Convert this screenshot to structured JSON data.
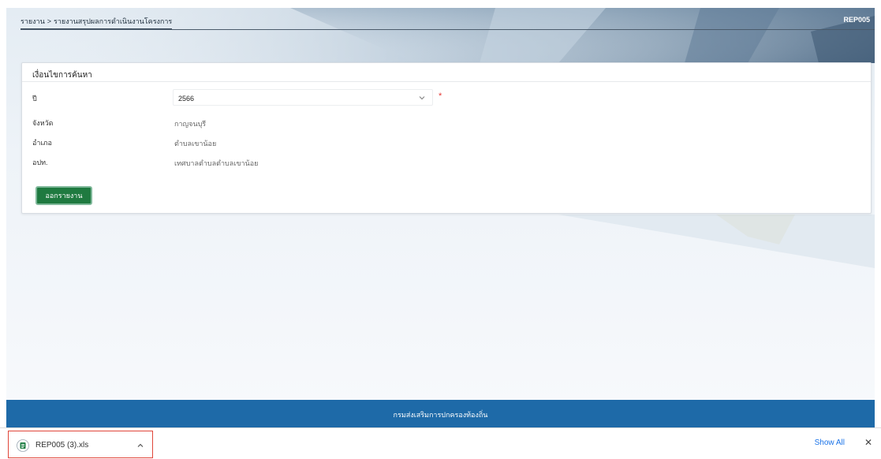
{
  "breadcrumb": {
    "parent": "รายงาน",
    "separator": ">",
    "current": "รายงานสรุปผลการดำเนินงานโครงการ"
  },
  "page_code": "REP005",
  "search": {
    "title": "เงื่อนไขการค้นหา",
    "year_label": "ปี",
    "year_value": "2566",
    "required_mark": "*",
    "province_label": "จังหวัด",
    "province_value": "กาญจนบุรี",
    "district_label": "อำเภอ",
    "district_value": "ตำบลเขาน้อย",
    "lao_label": "อปท.",
    "lao_value": "เทศบาลตำบลตำบลเขาน้อย",
    "submit_label": "ออกรายงาน"
  },
  "footer": {
    "text": "กรมส่งเสริมการปกครองท้องถิ่น"
  },
  "downloads": {
    "file_name": "REP005 (3).xls",
    "show_all_label": "Show All",
    "close_label": "✕"
  },
  "colors": {
    "primary_button": "#1f7a40",
    "footer_bg": "#1e6aa8",
    "required": "#e53935",
    "link": "#1a73e8"
  },
  "icons": {
    "select": "chevron-down-icon",
    "download_item": "chevron-up-icon",
    "file": "spreadsheet-file-icon"
  }
}
